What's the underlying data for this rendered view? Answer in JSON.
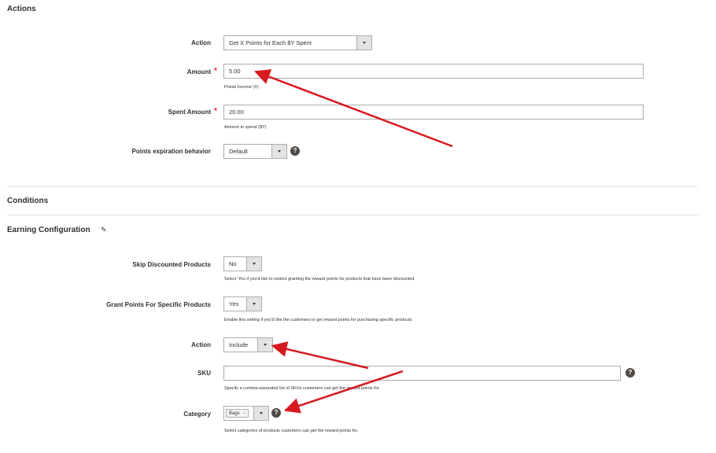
{
  "actions": {
    "title": "Actions",
    "action": {
      "label": "Action",
      "value": "Get X Points for Each $Y Spent"
    },
    "amount": {
      "label": "Amount",
      "required": "*",
      "value": "5.00",
      "note": "Points Income (X)"
    },
    "spent_amount": {
      "label": "Spent Amount",
      "required": "*",
      "value": "20.00",
      "note": "Amount to spend ($Y)"
    },
    "points_expiration": {
      "label": "Points expiration behavior",
      "value": "Default",
      "help_icon": "question-circle-icon"
    }
  },
  "conditions": {
    "title": "Conditions"
  },
  "earning": {
    "title": "Earning Configuration",
    "edit_icon": "pencil-icon",
    "skip_discounted": {
      "label": "Skip Discounted Products",
      "value": "No",
      "note": "Select 'Yes if you'd like to restrict granting the reward points for products that have been discounted."
    },
    "grant_specific": {
      "label": "Grant Points For Specific Products",
      "value": "Yes",
      "note": "Enable this setting if you'd like the customers to get reward points for purchasing specific products."
    },
    "action": {
      "label": "Action",
      "value": "Include"
    },
    "sku": {
      "label": "SKU",
      "value": "",
      "note": "Specify a comma-separated list of SKUs customers can get the reward points for.",
      "help_icon": "question-circle-icon"
    },
    "category": {
      "label": "Category",
      "tag": "Bags",
      "tag_remove": "×",
      "note": "Select categories of products customers can get the reward points for.",
      "help_icon": "question-circle-icon"
    }
  },
  "colors": {
    "arrow": "#d71920",
    "required": "#e22626",
    "help_bg": "#514943"
  }
}
